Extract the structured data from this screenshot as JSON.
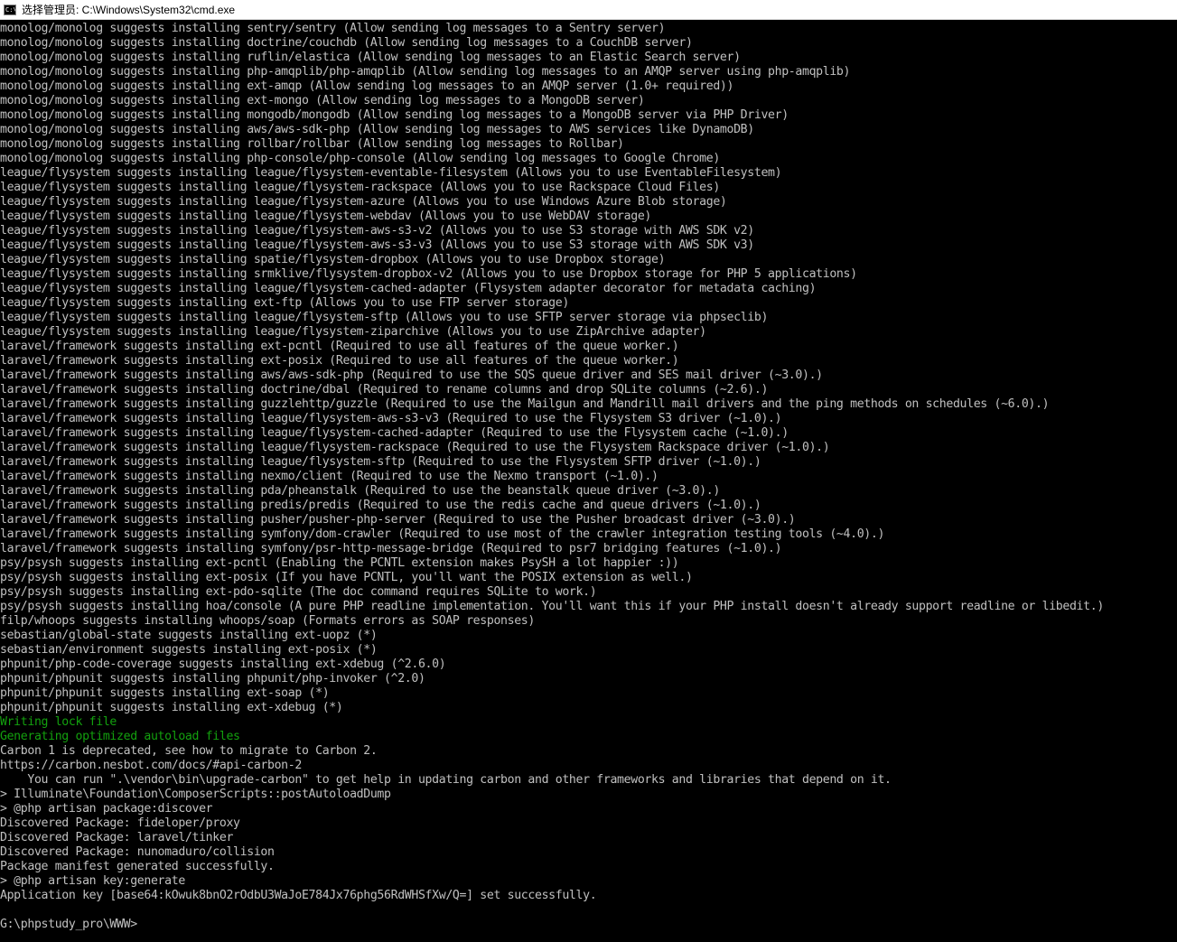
{
  "window": {
    "title": "选择管理员: C:\\Windows\\System32\\cmd.exe",
    "icon": "cmd-icon",
    "icon_text": "C:\\"
  },
  "colors": {
    "background": "#000000",
    "text": "#c0c0c0",
    "success": "#13a10e"
  },
  "console": {
    "lines": [
      {
        "text": "monolog/monolog suggests installing sentry/sentry (Allow sending log messages to a Sentry server)",
        "color": "default"
      },
      {
        "text": "monolog/monolog suggests installing doctrine/couchdb (Allow sending log messages to a CouchDB server)",
        "color": "default"
      },
      {
        "text": "monolog/monolog suggests installing ruflin/elastica (Allow sending log messages to an Elastic Search server)",
        "color": "default"
      },
      {
        "text": "monolog/monolog suggests installing php-amqplib/php-amqplib (Allow sending log messages to an AMQP server using php-amqplib)",
        "color": "default"
      },
      {
        "text": "monolog/monolog suggests installing ext-amqp (Allow sending log messages to an AMQP server (1.0+ required))",
        "color": "default"
      },
      {
        "text": "monolog/monolog suggests installing ext-mongo (Allow sending log messages to a MongoDB server)",
        "color": "default"
      },
      {
        "text": "monolog/monolog suggests installing mongodb/mongodb (Allow sending log messages to a MongoDB server via PHP Driver)",
        "color": "default"
      },
      {
        "text": "monolog/monolog suggests installing aws/aws-sdk-php (Allow sending log messages to AWS services like DynamoDB)",
        "color": "default"
      },
      {
        "text": "monolog/monolog suggests installing rollbar/rollbar (Allow sending log messages to Rollbar)",
        "color": "default"
      },
      {
        "text": "monolog/monolog suggests installing php-console/php-console (Allow sending log messages to Google Chrome)",
        "color": "default"
      },
      {
        "text": "league/flysystem suggests installing league/flysystem-eventable-filesystem (Allows you to use EventableFilesystem)",
        "color": "default"
      },
      {
        "text": "league/flysystem suggests installing league/flysystem-rackspace (Allows you to use Rackspace Cloud Files)",
        "color": "default"
      },
      {
        "text": "league/flysystem suggests installing league/flysystem-azure (Allows you to use Windows Azure Blob storage)",
        "color": "default"
      },
      {
        "text": "league/flysystem suggests installing league/flysystem-webdav (Allows you to use WebDAV storage)",
        "color": "default"
      },
      {
        "text": "league/flysystem suggests installing league/flysystem-aws-s3-v2 (Allows you to use S3 storage with AWS SDK v2)",
        "color": "default"
      },
      {
        "text": "league/flysystem suggests installing league/flysystem-aws-s3-v3 (Allows you to use S3 storage with AWS SDK v3)",
        "color": "default"
      },
      {
        "text": "league/flysystem suggests installing spatie/flysystem-dropbox (Allows you to use Dropbox storage)",
        "color": "default"
      },
      {
        "text": "league/flysystem suggests installing srmklive/flysystem-dropbox-v2 (Allows you to use Dropbox storage for PHP 5 applications)",
        "color": "default"
      },
      {
        "text": "league/flysystem suggests installing league/flysystem-cached-adapter (Flysystem adapter decorator for metadata caching)",
        "color": "default"
      },
      {
        "text": "league/flysystem suggests installing ext-ftp (Allows you to use FTP server storage)",
        "color": "default"
      },
      {
        "text": "league/flysystem suggests installing league/flysystem-sftp (Allows you to use SFTP server storage via phpseclib)",
        "color": "default"
      },
      {
        "text": "league/flysystem suggests installing league/flysystem-ziparchive (Allows you to use ZipArchive adapter)",
        "color": "default"
      },
      {
        "text": "laravel/framework suggests installing ext-pcntl (Required to use all features of the queue worker.)",
        "color": "default"
      },
      {
        "text": "laravel/framework suggests installing ext-posix (Required to use all features of the queue worker.)",
        "color": "default"
      },
      {
        "text": "laravel/framework suggests installing aws/aws-sdk-php (Required to use the SQS queue driver and SES mail driver (~3.0).)",
        "color": "default"
      },
      {
        "text": "laravel/framework suggests installing doctrine/dbal (Required to rename columns and drop SQLite columns (~2.6).)",
        "color": "default"
      },
      {
        "text": "laravel/framework suggests installing guzzlehttp/guzzle (Required to use the Mailgun and Mandrill mail drivers and the ping methods on schedules (~6.0).)",
        "color": "default"
      },
      {
        "text": "laravel/framework suggests installing league/flysystem-aws-s3-v3 (Required to use the Flysystem S3 driver (~1.0).)",
        "color": "default"
      },
      {
        "text": "laravel/framework suggests installing league/flysystem-cached-adapter (Required to use the Flysystem cache (~1.0).)",
        "color": "default"
      },
      {
        "text": "laravel/framework suggests installing league/flysystem-rackspace (Required to use the Flysystem Rackspace driver (~1.0).)",
        "color": "default"
      },
      {
        "text": "laravel/framework suggests installing league/flysystem-sftp (Required to use the Flysystem SFTP driver (~1.0).)",
        "color": "default"
      },
      {
        "text": "laravel/framework suggests installing nexmo/client (Required to use the Nexmo transport (~1.0).)",
        "color": "default"
      },
      {
        "text": "laravel/framework suggests installing pda/pheanstalk (Required to use the beanstalk queue driver (~3.0).)",
        "color": "default"
      },
      {
        "text": "laravel/framework suggests installing predis/predis (Required to use the redis cache and queue drivers (~1.0).)",
        "color": "default"
      },
      {
        "text": "laravel/framework suggests installing pusher/pusher-php-server (Required to use the Pusher broadcast driver (~3.0).)",
        "color": "default"
      },
      {
        "text": "laravel/framework suggests installing symfony/dom-crawler (Required to use most of the crawler integration testing tools (~4.0).)",
        "color": "default"
      },
      {
        "text": "laravel/framework suggests installing symfony/psr-http-message-bridge (Required to psr7 bridging features (~1.0).)",
        "color": "default"
      },
      {
        "text": "psy/psysh suggests installing ext-pcntl (Enabling the PCNTL extension makes PsySH a lot happier :))",
        "color": "default"
      },
      {
        "text": "psy/psysh suggests installing ext-posix (If you have PCNTL, you'll want the POSIX extension as well.)",
        "color": "default"
      },
      {
        "text": "psy/psysh suggests installing ext-pdo-sqlite (The doc command requires SQLite to work.)",
        "color": "default"
      },
      {
        "text": "psy/psysh suggests installing hoa/console (A pure PHP readline implementation. You'll want this if your PHP install doesn't already support readline or libedit.)",
        "color": "default"
      },
      {
        "text": "filp/whoops suggests installing whoops/soap (Formats errors as SOAP responses)",
        "color": "default"
      },
      {
        "text": "sebastian/global-state suggests installing ext-uopz (*)",
        "color": "default"
      },
      {
        "text": "sebastian/environment suggests installing ext-posix (*)",
        "color": "default"
      },
      {
        "text": "phpunit/php-code-coverage suggests installing ext-xdebug (^2.6.0)",
        "color": "default"
      },
      {
        "text": "phpunit/phpunit suggests installing phpunit/php-invoker (^2.0)",
        "color": "default"
      },
      {
        "text": "phpunit/phpunit suggests installing ext-soap (*)",
        "color": "default"
      },
      {
        "text": "phpunit/phpunit suggests installing ext-xdebug (*)",
        "color": "default"
      },
      {
        "text": "Writing lock file",
        "color": "green"
      },
      {
        "text": "Generating optimized autoload files",
        "color": "green"
      },
      {
        "text": "Carbon 1 is deprecated, see how to migrate to Carbon 2.",
        "color": "default"
      },
      {
        "text": "https://carbon.nesbot.com/docs/#api-carbon-2",
        "color": "default"
      },
      {
        "text": "    You can run \".\\vendor\\bin\\upgrade-carbon\" to get help in updating carbon and other frameworks and libraries that depend on it.",
        "color": "default"
      },
      {
        "text": "> Illuminate\\Foundation\\ComposerScripts::postAutoloadDump",
        "color": "default"
      },
      {
        "text": "> @php artisan package:discover",
        "color": "default"
      },
      {
        "text": "Discovered Package: fideloper/proxy",
        "color": "default"
      },
      {
        "text": "Discovered Package: laravel/tinker",
        "color": "default"
      },
      {
        "text": "Discovered Package: nunomaduro/collision",
        "color": "default"
      },
      {
        "text": "Package manifest generated successfully.",
        "color": "default"
      },
      {
        "text": "> @php artisan key:generate",
        "color": "default"
      },
      {
        "text": "Application key [base64:kOwuk8bnO2rOdbU3WaJoE784Jx76phg56RdWHSfXw/Q=] set successfully.",
        "color": "default"
      },
      {
        "text": "",
        "color": "default"
      },
      {
        "text": "G:\\phpstudy_pro\\WWW>",
        "color": "default"
      }
    ]
  }
}
